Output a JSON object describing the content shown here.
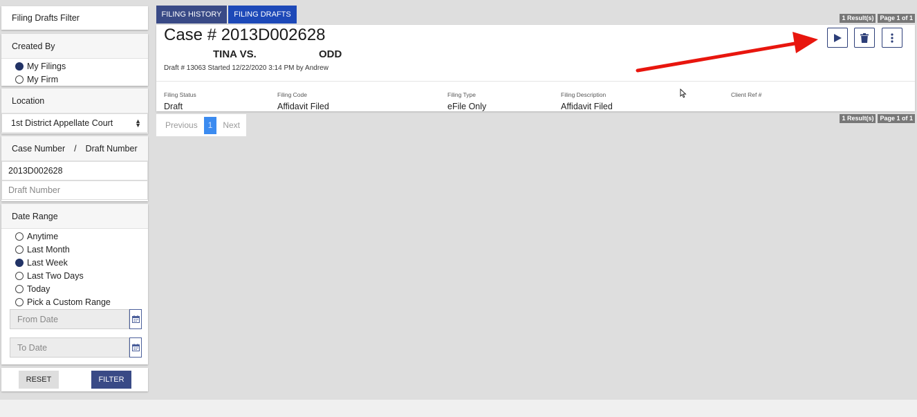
{
  "sidebar": {
    "header": "Filing Drafts Filter",
    "created_by": {
      "title": "Created By",
      "options": [
        "My Filings",
        "My Firm"
      ],
      "selected": 0
    },
    "location": {
      "title": "Location",
      "value": "1st District Appellate Court"
    },
    "case_draft": {
      "title_case": "Case Number",
      "separator": "/",
      "title_draft": "Draft Number",
      "case_number_value": "2013D002628",
      "draft_number_placeholder": "Draft Number"
    },
    "date_range": {
      "title": "Date Range",
      "options": [
        "Anytime",
        "Last Month",
        "Last Week",
        "Last Two Days",
        "Today",
        "Pick a Custom Range"
      ],
      "selected": 2,
      "from_placeholder": "From Date",
      "to_placeholder": "To Date"
    },
    "buttons": {
      "reset": "RESET",
      "filter": "FILTER"
    }
  },
  "tabs": [
    {
      "label": "FILING HISTORY",
      "active": false
    },
    {
      "label": "FILING DRAFTS",
      "active": true
    }
  ],
  "results": {
    "count_label": "1 Result(s)",
    "page_label": "Page 1 of 1"
  },
  "card": {
    "case_title": "Case # 2013D002628",
    "party_left": "TINA VS.",
    "party_right": "ODD",
    "draft_info": "Draft # 13063 Started 12/22/2020 3:14 PM by Andrew",
    "fields": [
      {
        "label": "Filing Status",
        "value": "Draft"
      },
      {
        "label": "Filing Code",
        "value": "Affidavit Filed"
      },
      {
        "label": "Filing Type",
        "value": "eFile Only"
      },
      {
        "label": "Filing Description",
        "value": "Affidavit Filed"
      },
      {
        "label": "Client Ref #",
        "value": ""
      }
    ]
  },
  "pagination": {
    "previous": "Previous",
    "current": "1",
    "next": "Next"
  },
  "colors": {
    "navy": "#394a86",
    "active_tab": "#1d49b8",
    "page_active": "#3b8bf0",
    "annotation_arrow": "#e8160e"
  },
  "icons": [
    "play-icon",
    "trash-icon",
    "more-vertical-icon",
    "calendar-icon",
    "select-caret-icon",
    "annotation-arrow",
    "mouse-cursor-icon"
  ]
}
